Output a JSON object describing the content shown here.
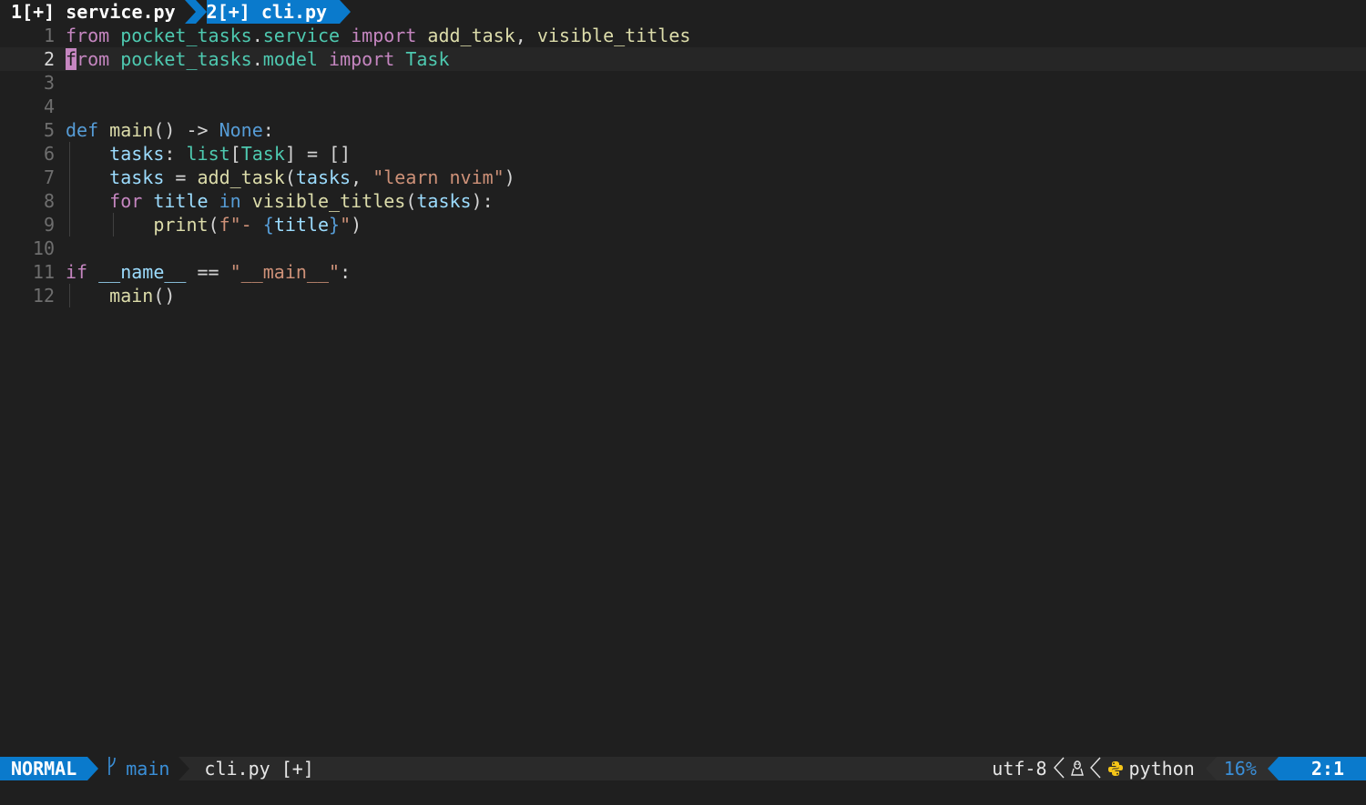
{
  "tabline": {
    "tabs": [
      {
        "label": "1[+] service.py",
        "active": false
      },
      {
        "label": "2[+] cli.py",
        "active": true
      }
    ]
  },
  "editor": {
    "cursor": {
      "line": 2,
      "col": 1
    },
    "lines": [
      {
        "num": "1",
        "tokens": [
          {
            "t": "from",
            "c": "kw"
          },
          {
            "t": " ",
            "c": "txt"
          },
          {
            "t": "pocket_tasks",
            "c": "mod"
          },
          {
            "t": ".",
            "c": "txt"
          },
          {
            "t": "service",
            "c": "mod"
          },
          {
            "t": " ",
            "c": "txt"
          },
          {
            "t": "import",
            "c": "kw"
          },
          {
            "t": " ",
            "c": "txt"
          },
          {
            "t": "add_task",
            "c": "fn"
          },
          {
            "t": ", ",
            "c": "txt"
          },
          {
            "t": "visible_titles",
            "c": "fn"
          }
        ]
      },
      {
        "num": "2",
        "tokens": [
          {
            "t": "f",
            "c": "cursor-ch"
          },
          {
            "t": "rom",
            "c": "kw"
          },
          {
            "t": " ",
            "c": "txt"
          },
          {
            "t": "pocket_tasks",
            "c": "mod"
          },
          {
            "t": ".",
            "c": "txt"
          },
          {
            "t": "model",
            "c": "mod"
          },
          {
            "t": " ",
            "c": "txt"
          },
          {
            "t": "import",
            "c": "kw"
          },
          {
            "t": " ",
            "c": "txt"
          },
          {
            "t": "Task",
            "c": "mod"
          }
        ]
      },
      {
        "num": "3",
        "tokens": []
      },
      {
        "num": "4",
        "tokens": []
      },
      {
        "num": "5",
        "tokens": [
          {
            "t": "def",
            "c": "kw2"
          },
          {
            "t": " ",
            "c": "txt"
          },
          {
            "t": "main",
            "c": "fn"
          },
          {
            "t": "() -> ",
            "c": "txt"
          },
          {
            "t": "None",
            "c": "kw2"
          },
          {
            "t": ":",
            "c": "txt"
          }
        ]
      },
      {
        "num": "6",
        "guides": [
          1
        ],
        "tokens": [
          {
            "t": "    ",
            "c": "txt"
          },
          {
            "t": "tasks",
            "c": "var"
          },
          {
            "t": ": ",
            "c": "txt"
          },
          {
            "t": "list",
            "c": "mod"
          },
          {
            "t": "[",
            "c": "txt"
          },
          {
            "t": "Task",
            "c": "mod"
          },
          {
            "t": "] = []",
            "c": "txt"
          }
        ]
      },
      {
        "num": "7",
        "guides": [
          1
        ],
        "tokens": [
          {
            "t": "    ",
            "c": "txt"
          },
          {
            "t": "tasks",
            "c": "var"
          },
          {
            "t": " = ",
            "c": "txt"
          },
          {
            "t": "add_task",
            "c": "fn"
          },
          {
            "t": "(",
            "c": "txt"
          },
          {
            "t": "tasks",
            "c": "var"
          },
          {
            "t": ", ",
            "c": "txt"
          },
          {
            "t": "\"learn nvim\"",
            "c": "str"
          },
          {
            "t": ")",
            "c": "txt"
          }
        ]
      },
      {
        "num": "8",
        "guides": [
          1
        ],
        "tokens": [
          {
            "t": "    ",
            "c": "txt"
          },
          {
            "t": "for",
            "c": "kw"
          },
          {
            "t": " ",
            "c": "txt"
          },
          {
            "t": "title",
            "c": "var"
          },
          {
            "t": " ",
            "c": "txt"
          },
          {
            "t": "in",
            "c": "kw2"
          },
          {
            "t": " ",
            "c": "txt"
          },
          {
            "t": "visible_titles",
            "c": "fn"
          },
          {
            "t": "(",
            "c": "txt"
          },
          {
            "t": "tasks",
            "c": "var"
          },
          {
            "t": "):",
            "c": "txt"
          }
        ]
      },
      {
        "num": "9",
        "guides": [
          1,
          2
        ],
        "tokens": [
          {
            "t": "        ",
            "c": "txt"
          },
          {
            "t": "print",
            "c": "fn"
          },
          {
            "t": "(",
            "c": "txt"
          },
          {
            "t": "f\"- ",
            "c": "str"
          },
          {
            "t": "{",
            "c": "kw2"
          },
          {
            "t": "title",
            "c": "var"
          },
          {
            "t": "}",
            "c": "kw2"
          },
          {
            "t": "\"",
            "c": "str"
          },
          {
            "t": ")",
            "c": "txt"
          }
        ]
      },
      {
        "num": "10",
        "tokens": []
      },
      {
        "num": "11",
        "tokens": [
          {
            "t": "if",
            "c": "kw"
          },
          {
            "t": " ",
            "c": "txt"
          },
          {
            "t": "__name__",
            "c": "var"
          },
          {
            "t": " == ",
            "c": "txt"
          },
          {
            "t": "\"__main__\"",
            "c": "str"
          },
          {
            "t": ":",
            "c": "txt"
          }
        ]
      },
      {
        "num": "12",
        "guides": [
          1
        ],
        "tokens": [
          {
            "t": "    ",
            "c": "txt"
          },
          {
            "t": "main",
            "c": "fn"
          },
          {
            "t": "()",
            "c": "txt"
          }
        ]
      }
    ]
  },
  "statusline": {
    "mode": "NORMAL",
    "branch_icon": "git-branch-icon",
    "branch": "main",
    "filename": "cli.py [+]",
    "encoding": "utf-8",
    "os_icon": "linux-penguin-icon",
    "filetype_icon": "python-icon",
    "filetype": "python",
    "percent": "16%",
    "position": "2:1",
    "colors": {
      "accent": "#0a7acc",
      "branch_text": "#3a8fd8",
      "cursor": "#c586c0"
    }
  }
}
